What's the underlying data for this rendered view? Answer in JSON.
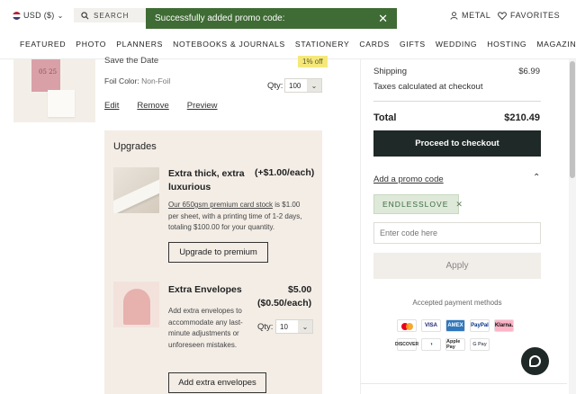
{
  "header": {
    "currency": "USD ($)",
    "search_label": "SEARCH",
    "toast_message": "Successfully added promo code:",
    "account_label": "METAL",
    "favorites_label": "FAVORITES",
    "nav": [
      "FEATURED",
      "PHOTO",
      "PLANNERS",
      "NOTEBOOKS & JOURNALS",
      "STATIONERY",
      "CARDS",
      "GIFTS",
      "WEDDING",
      "HOSTING",
      "MAGAZINE"
    ]
  },
  "product": {
    "thumb_text": "05 25",
    "name": "Save the Date",
    "discount_badge": "1% off",
    "foil_label": "Foil Color:",
    "foil_value": "Non-Foil",
    "qty_label": "Qty:",
    "qty_value": "100",
    "links": [
      "Edit",
      "Remove",
      "Preview"
    ]
  },
  "upgrades": {
    "title": "Upgrades",
    "premium": {
      "title": "Extra thick, extra luxurious",
      "price": "(+$1.00/each)",
      "desc_link": "Our 650gsm premium card stock",
      "desc_rest": " is $1.00 per sheet, with a printing time of 1-2 days, totaling $100.00 for your quantity.",
      "button": "Upgrade to premium"
    },
    "envelopes": {
      "title": "Extra Envelopes",
      "price": "$5.00",
      "each": "($0.50/each)",
      "desc": "Add extra envelopes to accommodate any last-minute adjustments or unforeseen mistakes.",
      "qty_label": "Qty:",
      "qty_value": "10",
      "button": "Add extra envelopes"
    }
  },
  "summary": {
    "shipping_label": "Shipping",
    "shipping_value": "$6.99",
    "taxes_label": "Taxes calculated at checkout",
    "total_label": "Total",
    "total_value": "$210.49",
    "checkout_button": "Proceed to checkout",
    "promo_link": "Add a promo code",
    "promo_code": "ENDLESSLOVE",
    "code_placeholder": "Enter code here",
    "apply_button": "Apply",
    "accepted_label": "Accepted payment methods",
    "payments_row1": [
      "MC",
      "VISA",
      "AMEX",
      "PayPal",
      "Klarna."
    ],
    "payments_row2": [
      "DISCOVER",
      "Diners",
      "Apple Pay",
      "G Pay"
    ]
  },
  "colors": {
    "toast_bg": "#3f6b34",
    "checkout_bg": "#1f2927",
    "upgrade_panel_bg": "#f3ede6",
    "promo_chip_bg": "#dfe9d9"
  }
}
